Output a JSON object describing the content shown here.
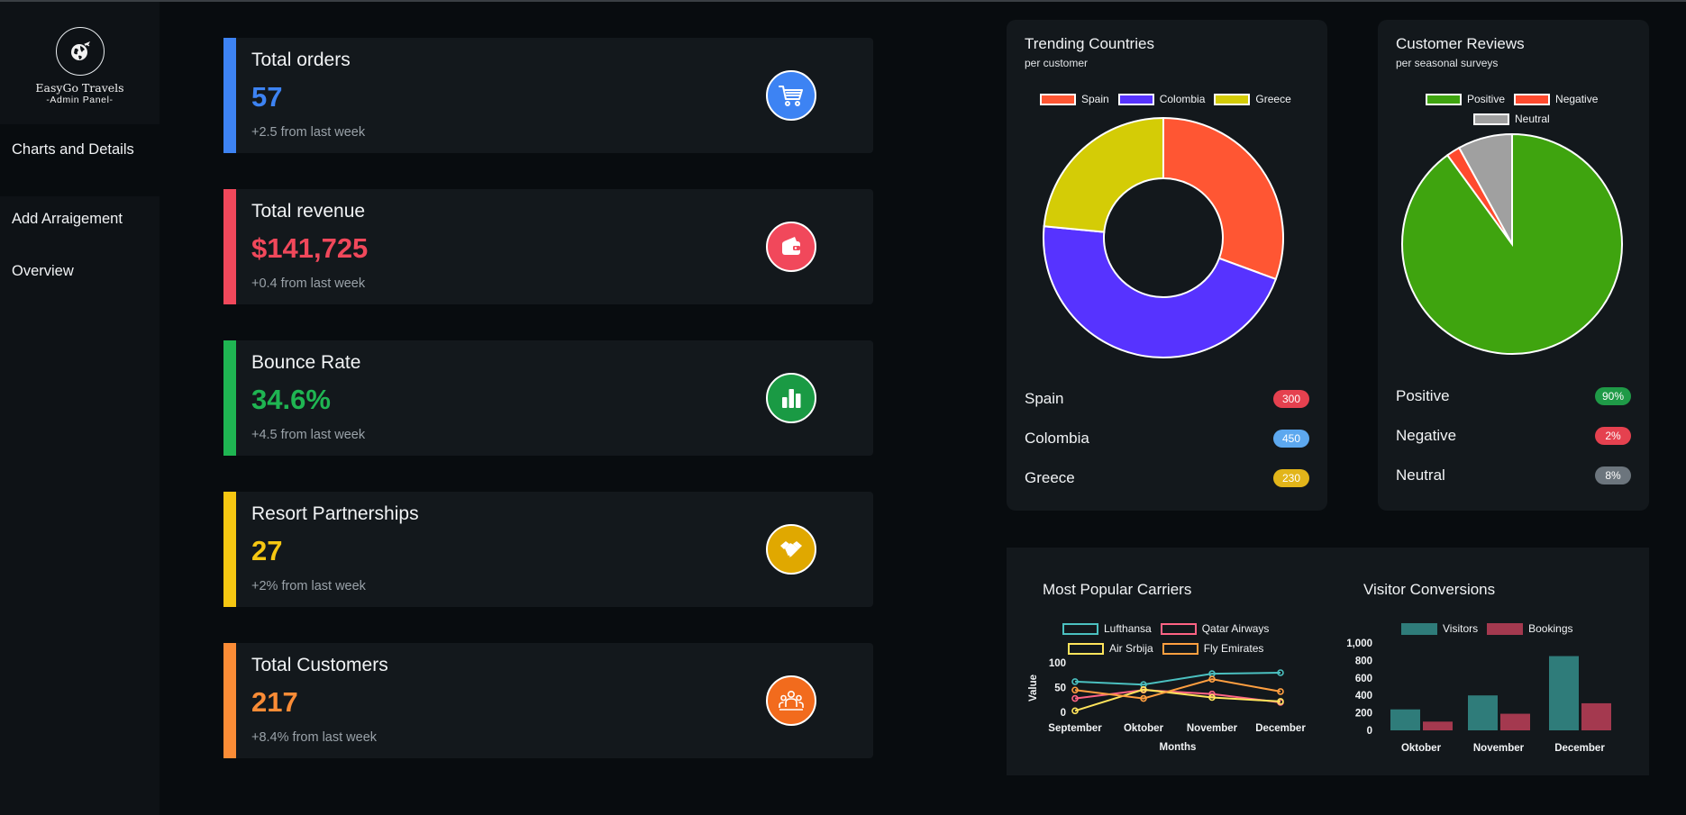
{
  "brand": {
    "name": "EasyGo Travels",
    "subtitle": "-Admin Panel-"
  },
  "nav": [
    {
      "label": "Charts and Details"
    },
    {
      "label": "Add Arraigement"
    },
    {
      "label": "Overview"
    }
  ],
  "stats": [
    {
      "title": "Total orders",
      "value": "57",
      "change": "+2.5 from last week",
      "color": "#3d83f3",
      "icon": "cart-icon"
    },
    {
      "title": "Total revenue",
      "value": "$141,725",
      "change": "+0.4 from last week",
      "color": "#f1485b",
      "icon": "wallet-icon"
    },
    {
      "title": "Bounce Rate",
      "value": "34.6%",
      "change": "+4.5 from last week",
      "color": "#1fb552",
      "icon": "bar-chart-icon"
    },
    {
      "title": "Resort Partnerships",
      "value": "27",
      "change": "+2% from last week",
      "color": "#f6c712",
      "icon": "handshake-icon"
    },
    {
      "title": "Total Customers",
      "value": "217",
      "change": "+8.4% from last week",
      "color": "#fb8c36",
      "icon": "people-icon"
    }
  ],
  "trending": {
    "title": "Trending Countries",
    "subtitle": "per customer",
    "rows": [
      {
        "label": "Spain",
        "badge": "300",
        "badge_color": "#e5414f"
      },
      {
        "label": "Colombia",
        "badge": "450",
        "badge_color": "#5da8ef"
      },
      {
        "label": "Greece",
        "badge": "230",
        "badge_color": "#e2b51a"
      }
    ]
  },
  "reviews": {
    "title": "Customer Reviews",
    "subtitle": "per seasonal surveys",
    "rows": [
      {
        "label": "Positive",
        "badge": "90%",
        "badge_color": "#1f9a47"
      },
      {
        "label": "Negative",
        "badge": "2%",
        "badge_color": "#e5414f"
      },
      {
        "label": "Neutral",
        "badge": "8%",
        "badge_color": "#6c757d"
      }
    ]
  },
  "carriers_title": "Most Popular Carriers",
  "conversions_title": "Visitor Conversions",
  "chart_data": [
    {
      "type": "pie",
      "variant": "doughnut",
      "categories": [
        "Spain",
        "Colombia",
        "Greece"
      ],
      "values": [
        300,
        450,
        230
      ],
      "colors": [
        "#ff5633",
        "#5733ff",
        "#d4cc06"
      ],
      "legend": "top"
    },
    {
      "type": "pie",
      "categories": [
        "Positive",
        "Negative",
        "Neutral"
      ],
      "values": [
        90,
        2,
        8
      ],
      "colors": [
        "#3fa40f",
        "#ff4a2e",
        "#a0a0a0"
      ],
      "legend": "top"
    },
    {
      "type": "line",
      "categories": [
        "September",
        "Oktober",
        "November",
        "December"
      ],
      "xlabel": "Months",
      "ylabel": "Value",
      "ylim": [
        0,
        100
      ],
      "yticks": [
        0,
        50,
        100
      ],
      "series": [
        {
          "name": "Lufthansa",
          "values": [
            62,
            56,
            78,
            80
          ],
          "color": "#4bc0c0"
        },
        {
          "name": "Qatar Airways",
          "values": [
            28,
            45,
            37,
            20
          ],
          "color": "#ff6384"
        },
        {
          "name": "Air Srbija",
          "values": [
            3,
            46,
            30,
            22
          ],
          "color": "#ffe45c"
        },
        {
          "name": "Fly Emirates",
          "values": [
            45,
            28,
            67,
            42
          ],
          "color": "#ff9f40"
        }
      ],
      "legend": "top",
      "grid": false
    },
    {
      "type": "bar",
      "categories": [
        "Oktober",
        "November",
        "December"
      ],
      "ylim": [
        0,
        1000
      ],
      "yticks": [
        "0",
        "200",
        "400",
        "600",
        "800",
        "1,000"
      ],
      "series": [
        {
          "name": "Visitors",
          "values": [
            240,
            400,
            850
          ],
          "color": "#2f7c7a"
        },
        {
          "name": "Bookings",
          "values": [
            100,
            190,
            310
          ],
          "color": "#a4394f"
        }
      ],
      "legend": "top",
      "grid": false
    }
  ]
}
